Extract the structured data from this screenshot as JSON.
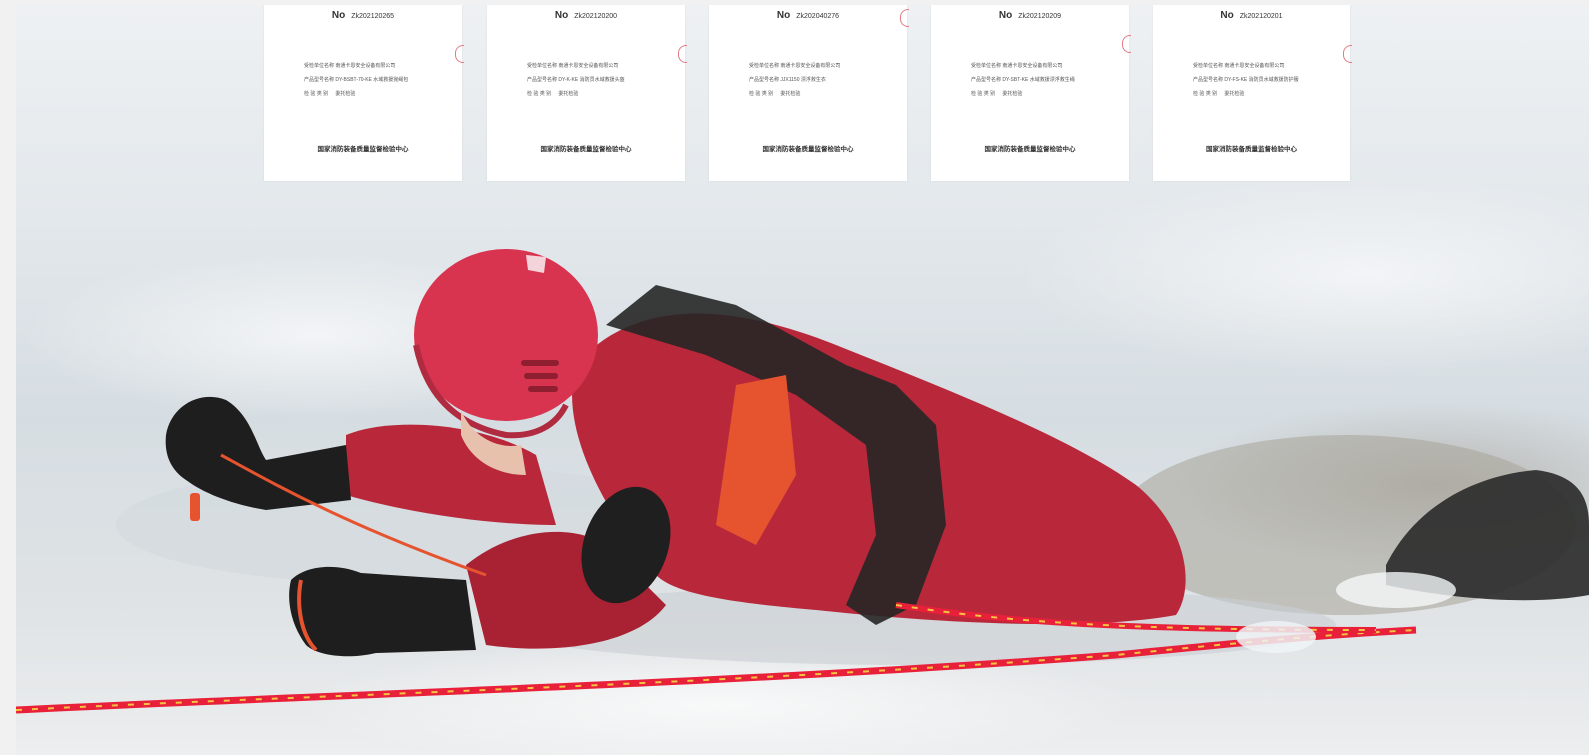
{
  "certificates": [
    {
      "no_mark": "No",
      "number": "Zk202120265",
      "client": "南通卡恩安全设备有限公司",
      "product": "DY-BSBT-70-KE 水域救援抛绳包",
      "inspection_type": "委托检验",
      "issuer": "国家消防装备质量监督检验中心"
    },
    {
      "no_mark": "No",
      "number": "Zk202120200",
      "client": "南通卡恩安全设备有限公司",
      "product": "DY-K-KE 消防员水域救援头盔",
      "inspection_type": "委托检验",
      "issuer": "国家消防装备质量监督检验中心"
    },
    {
      "no_mark": "No",
      "number": "Zk202040276",
      "client": "南通卡恩安全设备有限公司",
      "product": "JJX1150 漂浮救生衣",
      "inspection_type": "委托检验",
      "issuer": "国家消防装备质量监督检验中心"
    },
    {
      "no_mark": "No",
      "number": "Zk202120209",
      "client": "南通卡恩安全设备有限公司",
      "product": "DY-SBT-KE 水域救援漂浮救生绳",
      "inspection_type": "委托检验",
      "issuer": "国家消防装备质量监督检验中心"
    },
    {
      "no_mark": "No",
      "number": "Zk202120201",
      "client": "南通卡恩安全设备有限公司",
      "product": "DY-FS-KE 消防员水域救援防护服",
      "inspection_type": "委托检验",
      "issuer": "国家消防装备质量监督检验中心"
    }
  ],
  "labels": {
    "client_label": "受检单位名称",
    "product_label": "产品型号名称",
    "type_label": "检 验 类 别"
  },
  "photo": {
    "subject": "ice-rescue-responder",
    "colors": {
      "suit": "#b8283a",
      "helmet": "#d8334f",
      "rope": "#e8203a",
      "ice": "#dde3e7",
      "gloves": "#1e1e1e"
    }
  }
}
